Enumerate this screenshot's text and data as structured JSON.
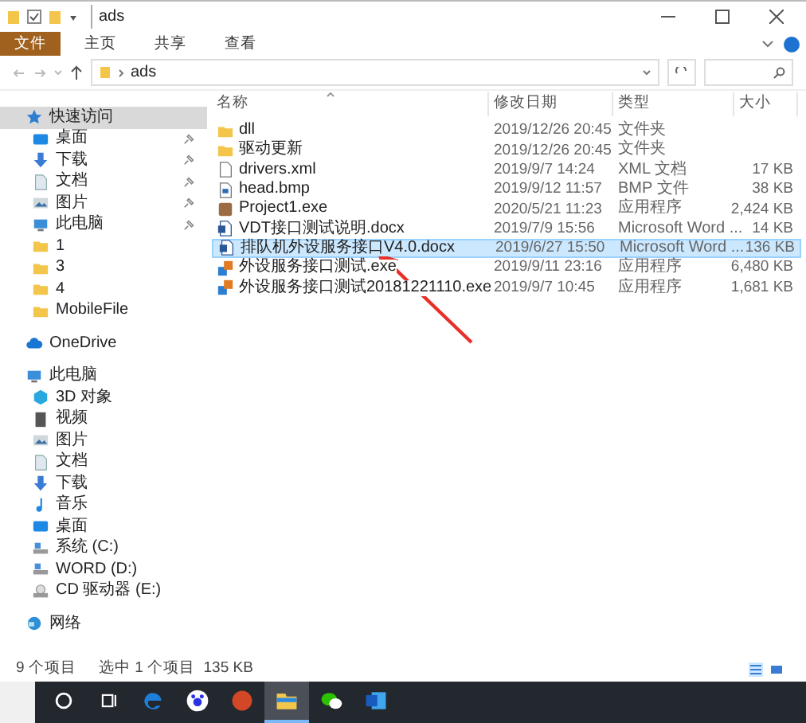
{
  "window": {
    "title": "ads"
  },
  "ribbon_tabs": [
    {
      "label": "文件",
      "selected": true
    },
    {
      "label": "主页",
      "selected": false
    },
    {
      "label": "共享",
      "selected": false
    },
    {
      "label": "查看",
      "selected": false
    }
  ],
  "address": {
    "path": "ads"
  },
  "sidebar": {
    "items": [
      {
        "label": "快速访问",
        "kind": "star",
        "selected": true,
        "children": [
          {
            "label": "桌面",
            "kind": "desktop",
            "pinned": true
          },
          {
            "label": "下载",
            "kind": "download",
            "pinned": true
          },
          {
            "label": "文档",
            "kind": "document",
            "pinned": true
          },
          {
            "label": "图片",
            "kind": "picture",
            "pinned": true
          },
          {
            "label": "此电脑",
            "kind": "pc",
            "pinned": true
          },
          {
            "label": "1",
            "kind": "folder",
            "pinned": false
          },
          {
            "label": "3",
            "kind": "folder",
            "pinned": false
          },
          {
            "label": "4",
            "kind": "folder",
            "pinned": false
          },
          {
            "label": "MobileFile",
            "kind": "folder",
            "pinned": false
          }
        ]
      },
      {
        "label": "OneDrive",
        "kind": "cloud",
        "selected": false
      },
      {
        "label": "此电脑",
        "kind": "pc",
        "selected": false,
        "children": [
          {
            "label": "3D 对象",
            "kind": "cube"
          },
          {
            "label": "视频",
            "kind": "video"
          },
          {
            "label": "图片",
            "kind": "picture"
          },
          {
            "label": "文档",
            "kind": "document"
          },
          {
            "label": "下载",
            "kind": "download"
          },
          {
            "label": "音乐",
            "kind": "music"
          },
          {
            "label": "桌面",
            "kind": "desktop"
          },
          {
            "label": "系统 (C:)",
            "kind": "drive"
          },
          {
            "label": "WORD (D:)",
            "kind": "drive"
          },
          {
            "label": "CD 驱动器 (E:)",
            "kind": "cd"
          }
        ]
      },
      {
        "label": "网络",
        "kind": "network",
        "selected": false
      }
    ]
  },
  "table": {
    "columns": [
      "名称",
      "修改日期",
      "类型",
      "大小"
    ],
    "rows": [
      {
        "name": "dll",
        "date": "2019/12/26 20:45",
        "type": "文件夹",
        "size": "",
        "kind": "folder",
        "selected": false
      },
      {
        "name": "驱动更新",
        "date": "2019/12/26 20:45",
        "type": "文件夹",
        "size": "",
        "kind": "folder",
        "selected": false
      },
      {
        "name": "drivers.xml",
        "date": "2019/9/7 14:24",
        "type": "XML 文档",
        "size": "17 KB",
        "kind": "xml",
        "selected": false
      },
      {
        "name": "head.bmp",
        "date": "2019/9/12 11:57",
        "type": "BMP 文件",
        "size": "38 KB",
        "kind": "image",
        "selected": false
      },
      {
        "name": "Project1.exe",
        "date": "2020/5/21 11:23",
        "type": "应用程序",
        "size": "2,424 KB",
        "kind": "app",
        "selected": false
      },
      {
        "name": "VDT接口测试说明.docx",
        "date": "2019/7/9 15:56",
        "type": "Microsoft Word ...",
        "size": "14 KB",
        "kind": "docx",
        "selected": false
      },
      {
        "name": "排队机外设服务接口V4.0.docx",
        "date": "2019/6/27 15:50",
        "type": "Microsoft Word ...",
        "size": "136 KB",
        "kind": "docx",
        "selected": true
      },
      {
        "name": "外设服务接口测试.exe",
        "date": "2019/9/11 23:16",
        "type": "应用程序",
        "size": "6,480 KB",
        "kind": "exe",
        "selected": false
      },
      {
        "name": "外设服务接口测试20181221110.exe",
        "date": "2019/9/7 10:45",
        "type": "应用程序",
        "size": "1,681 KB",
        "kind": "exe",
        "selected": false
      }
    ]
  },
  "status_bar": {
    "count": "9 个项目",
    "selection": "选中 1 个项目  135 KB"
  },
  "taskbar": {
    "apps": [
      {
        "kind": "search",
        "active": false
      },
      {
        "kind": "taskview",
        "active": false
      },
      {
        "kind": "edge",
        "active": false
      },
      {
        "kind": "paw",
        "active": false
      },
      {
        "kind": "slides",
        "active": false
      },
      {
        "kind": "explorer",
        "active": true
      },
      {
        "kind": "chat",
        "active": false
      },
      {
        "kind": "word",
        "active": false
      }
    ]
  }
}
